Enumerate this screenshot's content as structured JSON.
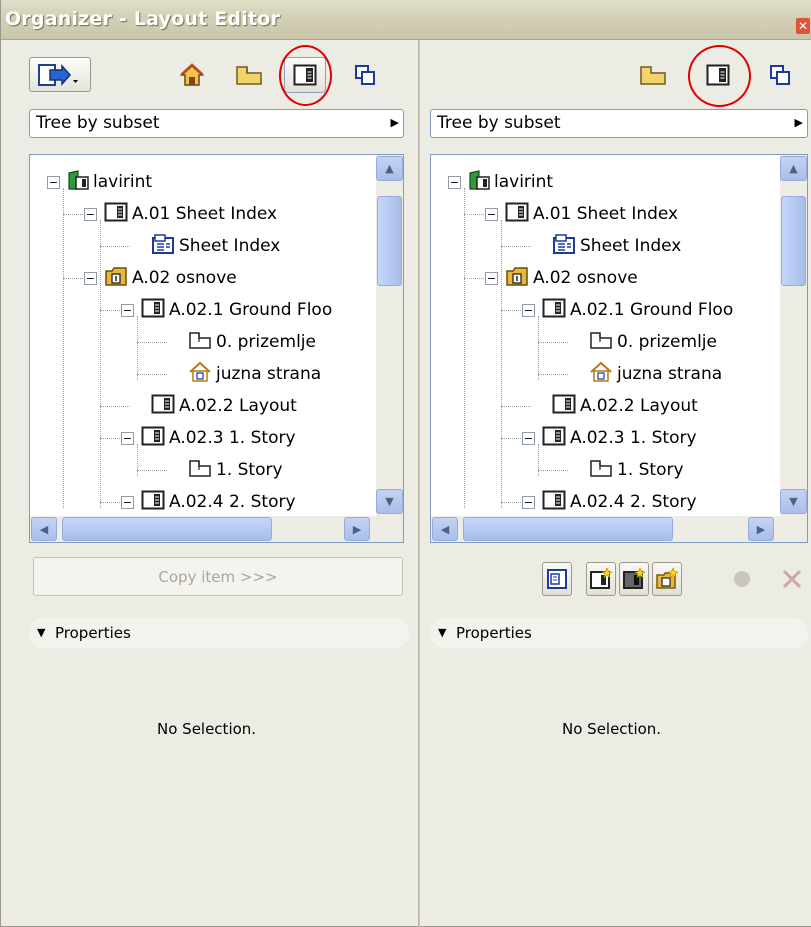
{
  "window": {
    "title": "Organizer - Layout Editor",
    "close_icon": "close-icon"
  },
  "left": {
    "toolbar": {
      "publisher_icon": "publisher-arrow-icon",
      "icons": [
        "project-map-icon",
        "view-map-icon",
        "layout-book-icon",
        "publisher-sets-icon"
      ],
      "active": "layout-book-icon"
    },
    "dropdown": "Tree by subset",
    "tree": [
      {
        "label": "lavirint",
        "icon": "project-book-icon",
        "expander": "⊟"
      },
      {
        "label": "A.01 Sheet Index",
        "icon": "layout-icon",
        "expander": "⊟"
      },
      {
        "label": "Sheet Index",
        "icon": "schedule-icon",
        "expander": ""
      },
      {
        "label": "A.02 osnove",
        "icon": "subset-icon",
        "expander": "⊟"
      },
      {
        "label": "A.02.1 Ground Floo",
        "icon": "layout-icon",
        "expander": "⊟"
      },
      {
        "label": "0. prizemlje",
        "icon": "floorplan-icon",
        "expander": ""
      },
      {
        "label": "juzna strana",
        "icon": "elevation-icon",
        "expander": ""
      },
      {
        "label": "A.02.2 Layout",
        "icon": "layout-icon",
        "expander": ""
      },
      {
        "label": "A.02.3 1. Story",
        "icon": "layout-icon",
        "expander": "⊟"
      },
      {
        "label": "1. Story",
        "icon": "floorplan-icon",
        "expander": ""
      },
      {
        "label": "A.02.4 2. Story",
        "icon": "layout-icon",
        "expander": "⊟"
      }
    ],
    "copy_button": "Copy item >>>",
    "properties_label": "Properties",
    "no_selection": "No Selection."
  },
  "right": {
    "toolbar": {
      "icons": [
        "view-map-icon",
        "layout-book-icon",
        "publisher-sets-icon"
      ],
      "active": "layout-book-icon"
    },
    "dropdown": "Tree by subset",
    "tree": [
      {
        "label": "lavirint",
        "icon": "project-book-icon",
        "expander": "⊟"
      },
      {
        "label": "A.01 Sheet Index",
        "icon": "layout-icon",
        "expander": "⊟"
      },
      {
        "label": "Sheet Index",
        "icon": "schedule-icon",
        "expander": ""
      },
      {
        "label": "A.02 osnove",
        "icon": "subset-icon",
        "expander": "⊟"
      },
      {
        "label": "A.02.1 Ground Floo",
        "icon": "layout-icon",
        "expander": "⊟"
      },
      {
        "label": "0. prizemlje",
        "icon": "floorplan-icon",
        "expander": ""
      },
      {
        "label": "juzna strana",
        "icon": "elevation-icon",
        "expander": ""
      },
      {
        "label": "A.02.2 Layout",
        "icon": "layout-icon",
        "expander": ""
      },
      {
        "label": "A.02.3 1. Story",
        "icon": "layout-icon",
        "expander": "⊟"
      },
      {
        "label": "1. Story",
        "icon": "floorplan-icon",
        "expander": ""
      },
      {
        "label": "A.02.4 2. Story",
        "icon": "layout-icon",
        "expander": "⊟"
      }
    ],
    "actions": [
      "new-master-icon",
      "new-layout-icon",
      "new-layout-dark-icon",
      "new-subset-icon",
      "settings-dot-icon",
      "delete-icon"
    ],
    "properties_label": "Properties",
    "no_selection": "No Selection."
  },
  "colors": {
    "annotation_circle": "#e00000",
    "panel_bg": "#ecebe4",
    "selection_border": "#7f9db9"
  }
}
